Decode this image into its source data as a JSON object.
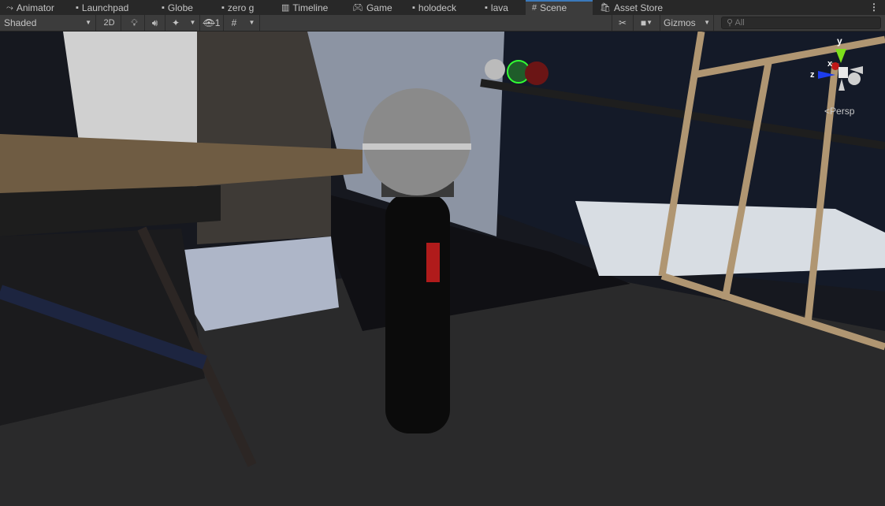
{
  "tabs": [
    {
      "label": "Animator",
      "icon": "animator-icon"
    },
    {
      "label": "Launchpad",
      "icon": "scene-file-icon"
    },
    {
      "label": "Globe",
      "icon": "scene-file-icon"
    },
    {
      "label": "zero g",
      "icon": "scene-file-icon"
    },
    {
      "label": "Timeline",
      "icon": "timeline-icon"
    },
    {
      "label": "Game",
      "icon": "gamepad-icon"
    },
    {
      "label": "holodeck",
      "icon": "scene-file-icon"
    },
    {
      "label": "lava",
      "icon": "scene-file-icon"
    },
    {
      "label": "Scene",
      "icon": "grid-hash-icon",
      "active": true
    },
    {
      "label": "Asset Store",
      "icon": "shopping-bag-icon"
    }
  ],
  "toolbar": {
    "shading_mode": "Shaded",
    "mode_2d": "2D",
    "hidden_count": "1",
    "gizmos_label": "Gizmos",
    "search_placeholder": "All"
  },
  "gizmo": {
    "x": "x",
    "y": "y",
    "z": "z",
    "projection": "Persp"
  }
}
